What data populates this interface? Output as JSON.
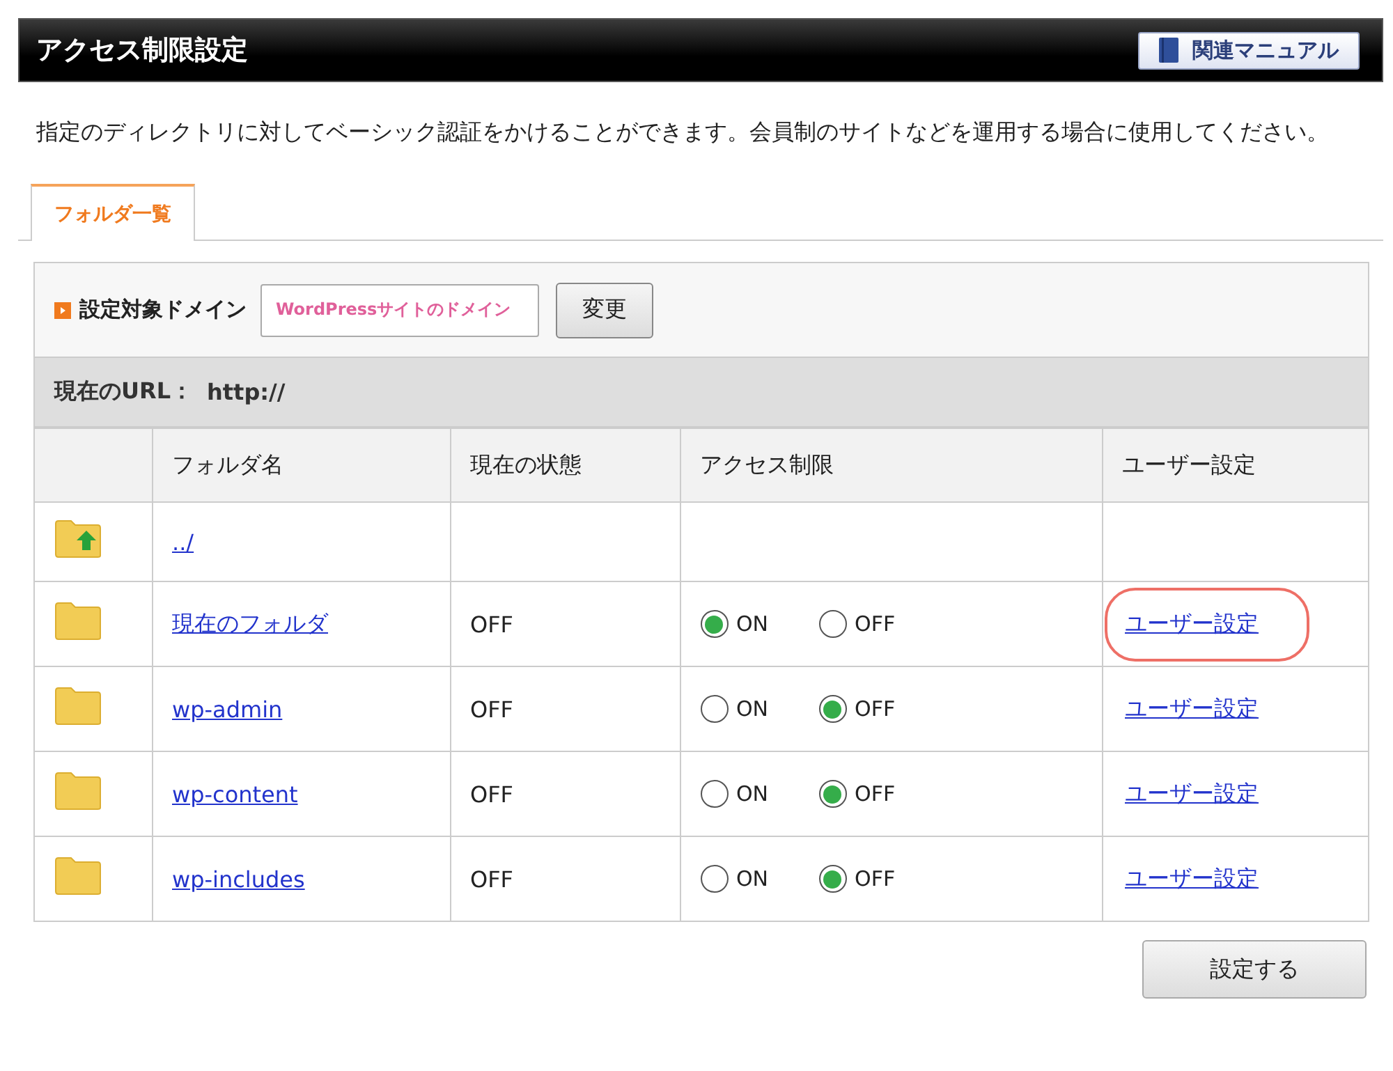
{
  "header": {
    "title": "アクセス制限設定",
    "manual_button": "関連マニュアル"
  },
  "description": "指定のディレクトリに対してベーシック認証をかけることができます。会員制のサイトなどを運用する場合に使用してください。",
  "tabs": [
    {
      "label": "フォルダ一覧",
      "selected": true
    }
  ],
  "domain": {
    "label": "設定対象ドメイン",
    "value": "WordPressサイトのドメイン",
    "button": "変更"
  },
  "url": {
    "label": "現在のURL：",
    "value": "http://"
  },
  "table": {
    "columns": [
      "フォルダ名",
      "現在の状態",
      "アクセス制限",
      "ユーザー設定"
    ],
    "rows": [
      {
        "kind": "parent",
        "name": "../"
      },
      {
        "kind": "folder",
        "name": "現在のフォルダ",
        "status": "OFF",
        "on_label": "ON",
        "off_label": "OFF",
        "access_on": true,
        "user_link": "ユーザー設定",
        "highlighted": true
      },
      {
        "kind": "folder",
        "name": "wp-admin",
        "status": "OFF",
        "on_label": "ON",
        "off_label": "OFF",
        "access_on": false,
        "user_link": "ユーザー設定",
        "highlighted": false
      },
      {
        "kind": "folder",
        "name": "wp-content",
        "status": "OFF",
        "on_label": "ON",
        "off_label": "OFF",
        "access_on": false,
        "user_link": "ユーザー設定",
        "highlighted": false
      },
      {
        "kind": "folder",
        "name": "wp-includes",
        "status": "OFF",
        "on_label": "ON",
        "off_label": "OFF",
        "access_on": false,
        "user_link": "ユーザー設定",
        "highlighted": false
      }
    ]
  },
  "submit_button": "設定する"
}
